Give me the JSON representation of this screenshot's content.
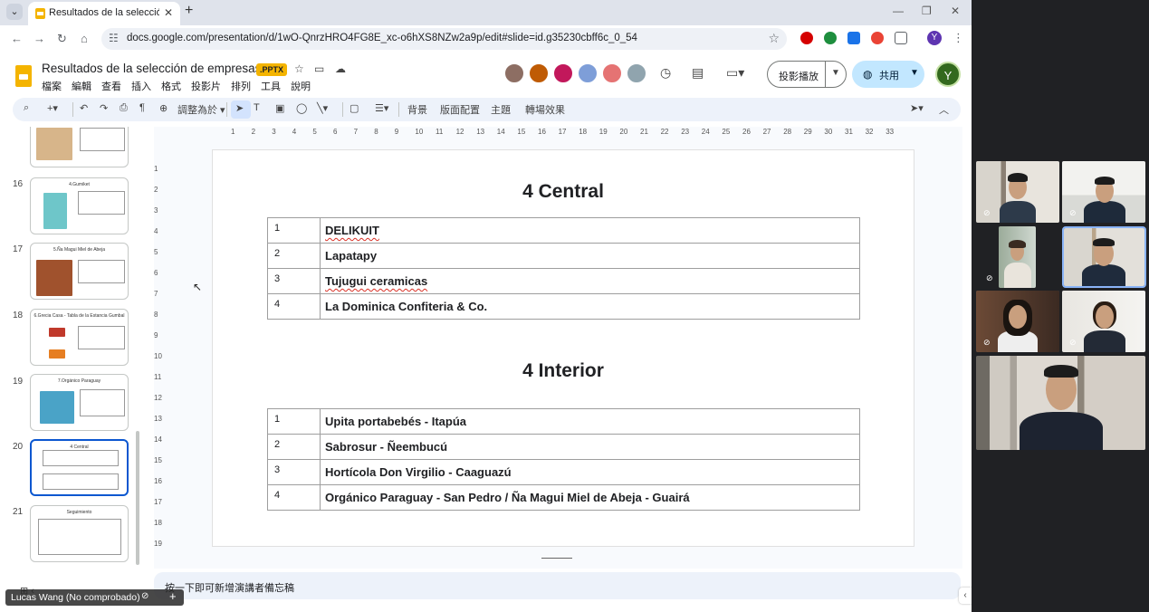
{
  "browser": {
    "tab_title": "Resultados de la selección de",
    "tab_close": "✕",
    "new_tab": "+",
    "url": "docs.google.com/presentation/d/1wO-QnrzHRO4FG8E_xc-o6hXS8NZw2a9p/edit#slide=id.g35230cbff6c_0_54",
    "window_controls": [
      "—",
      "❐",
      "✕"
    ],
    "profile_initial": "Y"
  },
  "app": {
    "doc_title": "Resultados de la selección de empresas",
    "badge": ".PPTX",
    "menu": [
      "檔案",
      "編輯",
      "查看",
      "插入",
      "格式",
      "投影片",
      "排列",
      "工具",
      "說明"
    ],
    "present_label": "投影播放",
    "share_label": "共用",
    "user_initial": "Y"
  },
  "toolbar": {
    "zoom_label": "調整為於",
    "background": "背景",
    "layout": "版面配置",
    "theme": "主題",
    "transition": "轉場效果"
  },
  "filmstrip": {
    "slides": [
      {
        "num": "",
        "title": ""
      },
      {
        "num": "16",
        "title": "4.Gumiket"
      },
      {
        "num": "17",
        "title": "5.Ña Magui Miel de Abeja"
      },
      {
        "num": "18",
        "title": "6.Grecia Casa - Tabla de la Estancia Gumbal"
      },
      {
        "num": "19",
        "title": "7.Orgánico Paraguay"
      },
      {
        "num": "20",
        "title": "4 Central"
      },
      {
        "num": "21",
        "title": "Seguimiento"
      }
    ]
  },
  "ruler": {
    "top": [
      "1",
      "2",
      "3",
      "4",
      "5",
      "6",
      "7",
      "8",
      "9",
      "10",
      "11",
      "12",
      "13",
      "14",
      "15",
      "16",
      "17",
      "18",
      "19",
      "20",
      "21",
      "22",
      "23",
      "24",
      "25",
      "26",
      "27",
      "28",
      "29",
      "30",
      "31",
      "32",
      "33"
    ],
    "left": [
      "1",
      "2",
      "3",
      "4",
      "5",
      "6",
      "7",
      "8",
      "9",
      "10",
      "11",
      "12",
      "13",
      "14",
      "15",
      "16",
      "17",
      "18",
      "19"
    ]
  },
  "slide": {
    "central": {
      "title": "4 Central",
      "rows": [
        {
          "num": "1",
          "name": "DELIKUIT"
        },
        {
          "num": "2",
          "name": "Lapatapy"
        },
        {
          "num": "3",
          "name": "Tujugui ceramicas"
        },
        {
          "num": "4",
          "name": "La Dominica Confiteria & Co."
        }
      ]
    },
    "interior": {
      "title": "4 Interior",
      "rows": [
        {
          "num": "1",
          "name": "Upita portabebés - Itapúa"
        },
        {
          "num": "2",
          "name": "Sabrosur - Ñeembucú"
        },
        {
          "num": "3",
          "name": "Hortícola Don Virgilio - Caaguazú"
        },
        {
          "num": "4",
          "name": "Orgánico Paraguay - San Pedro / Ña Magui Miel de Abeja - Guairá"
        }
      ]
    }
  },
  "notes": {
    "placeholder": "按一下即可新增演講者備忘稿"
  },
  "meeting": {
    "self_name": "Lucas Wang (No comprobado)"
  },
  "colors": {
    "accent": "#0b57d0",
    "share_bg": "#c2e7ff",
    "toolbar_bg": "#edf2fa",
    "slides_yellow": "#f4b400"
  }
}
